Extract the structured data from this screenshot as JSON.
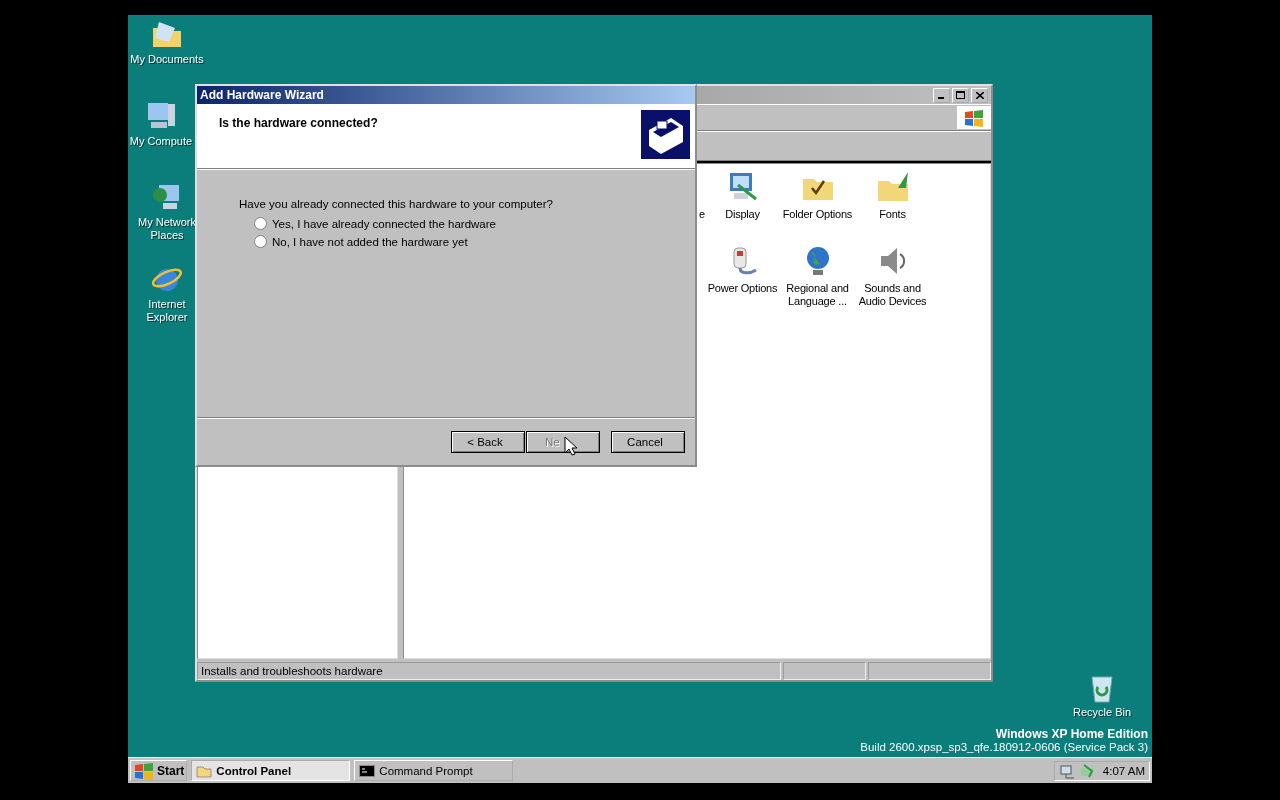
{
  "desktop_icons": [
    {
      "label": "My Documents",
      "kind": "documents"
    },
    {
      "label": "My Compute",
      "kind": "computer"
    },
    {
      "label": "My Network Places",
      "kind": "network"
    },
    {
      "label": "Internet Explorer",
      "kind": "browser"
    }
  ],
  "recycle_bin": {
    "label": "Recycle Bin"
  },
  "os_info": {
    "edition": "Windows XP Home Edition",
    "build": "Build 2600.xpsp_sp3_qfe.180912-0606 (Service Pack 3)"
  },
  "control_panel": {
    "rows": [
      [
        {
          "label": "e",
          "kind": "partial"
        },
        {
          "label": "Display",
          "kind": "display"
        },
        {
          "label": "Folder Options",
          "kind": "folder-options"
        },
        {
          "label": "Fonts",
          "kind": "fonts"
        }
      ],
      [
        {
          "kind": "empty"
        },
        {
          "label": "Power Options",
          "kind": "power"
        },
        {
          "label": "Regional and Language ...",
          "kind": "regional"
        },
        {
          "label": "Sounds and Audio Devices",
          "kind": "sounds"
        }
      ]
    ],
    "status_bar": "Installs and troubleshoots hardware"
  },
  "wizard": {
    "title": "Add Hardware Wizard",
    "heading": "Is the hardware connected?",
    "question": "Have you already connected this hardware to your computer?",
    "options": [
      {
        "label": "Yes, I have already connected the hardware",
        "selected": false
      },
      {
        "label": "No, I have not added the hardware yet",
        "selected": false
      }
    ],
    "buttons": [
      {
        "label": "< Back",
        "disabled": false
      },
      {
        "label": "Ne",
        "disabled": true
      },
      {
        "label": "Cancel",
        "disabled": false
      }
    ]
  },
  "taskbar": {
    "start": "Start",
    "tasks": [
      {
        "label": "Control Panel",
        "kind": "folder",
        "selected": true
      },
      {
        "label": "Command Prompt",
        "kind": "console",
        "selected": false
      }
    ],
    "clock": "4:07 AM"
  }
}
